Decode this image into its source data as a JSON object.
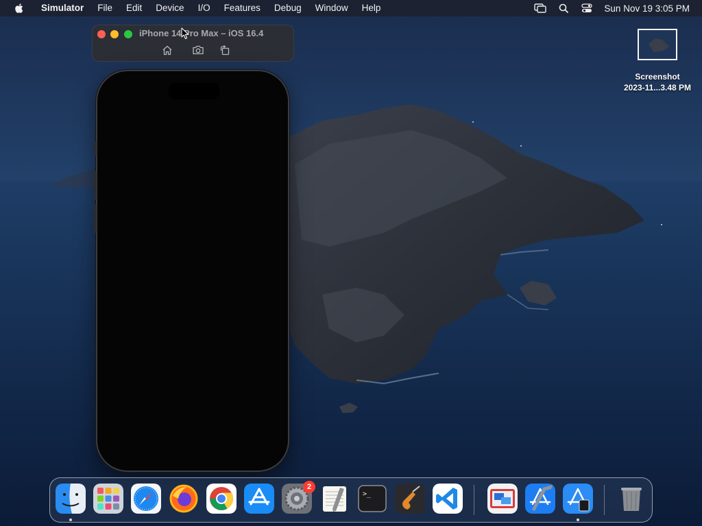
{
  "menubar": {
    "app_name": "Simulator",
    "menus": [
      "File",
      "Edit",
      "Device",
      "I/O",
      "Features",
      "Debug",
      "Window",
      "Help"
    ],
    "status_icons": [
      "screen-mirroring-icon",
      "search-icon",
      "control-center-icon"
    ],
    "clock": "Sun Nov 19  3:05 PM"
  },
  "simulator_window": {
    "title": "iPhone 14 Pro Max – iOS 16.4",
    "toolbar": [
      "home-icon",
      "camera-icon",
      "rotate-icon"
    ],
    "screen_color": "#050505"
  },
  "desktop_file": {
    "line1": "Screenshot",
    "line2": "2023-11...3.48 PM"
  },
  "dock": {
    "apps": [
      {
        "name": "Finder",
        "icon": "finder-icon",
        "running": true
      },
      {
        "name": "Launchpad",
        "icon": "launchpad-icon",
        "running": false
      },
      {
        "name": "Safari",
        "icon": "safari-icon",
        "running": false
      },
      {
        "name": "Firefox",
        "icon": "firefox-icon",
        "running": false
      },
      {
        "name": "Chrome",
        "icon": "chrome-icon",
        "running": false
      },
      {
        "name": "App Store",
        "icon": "app-store-icon",
        "running": false
      },
      {
        "name": "System Settings",
        "icon": "settings-icon",
        "running": false,
        "badge": "2"
      },
      {
        "name": "TextEdit",
        "icon": "textedit-icon",
        "running": false
      },
      {
        "name": "Terminal",
        "icon": "terminal-icon",
        "running": false
      },
      {
        "name": "GarageBand",
        "icon": "garageband-icon",
        "running": false
      },
      {
        "name": "Visual Studio Code",
        "icon": "vscode-icon",
        "running": false
      },
      {
        "name": "Screen Sharing",
        "icon": "screen-sharing-icon",
        "running": false
      },
      {
        "name": "Xcode",
        "icon": "xcode-icon",
        "running": false
      },
      {
        "name": "Simulator",
        "icon": "simulator-icon",
        "running": true
      },
      {
        "name": "Trash",
        "icon": "trash-icon",
        "running": false
      }
    ]
  },
  "colors": {
    "accent_red": "#ff3b30",
    "menubar_bg": "#1c2230",
    "wallpaper_sky": "#1b3458",
    "wallpaper_sea": "#0f2445"
  }
}
